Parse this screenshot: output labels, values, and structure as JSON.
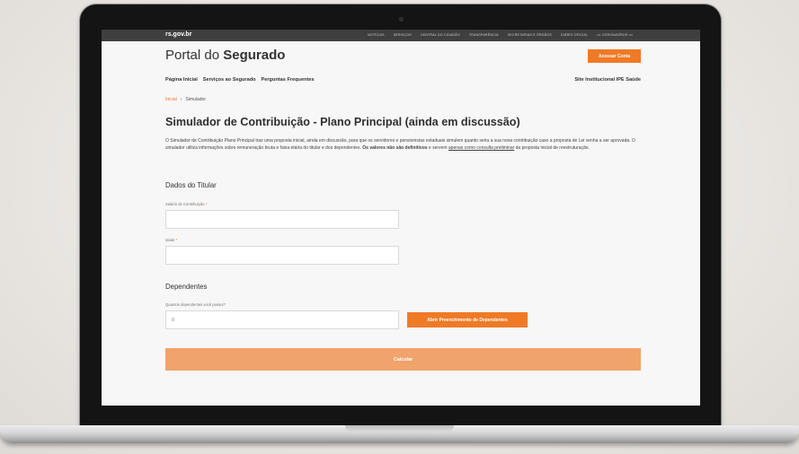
{
  "topbar": {
    "site": "rs.gov.br",
    "links": [
      "NOTÍCIAS",
      "SERVIÇOS",
      "CENTRAL DO CIDADÃO",
      "TRANSPARÊNCIA",
      "SECRETARIAS E ÓRGÃOS",
      "DIÁRIO OFICIAL",
      "••• CORONAVÍRUS •••"
    ]
  },
  "header": {
    "title_prefix": "Portal do ",
    "title_bold": "Segurado",
    "login_button": "Acessar Conta"
  },
  "nav": {
    "items": [
      "Página Inicial",
      "Serviços ao Segurado",
      "Perguntas Frequentes"
    ],
    "right_link": "Site Institucional IPE Saúde"
  },
  "breadcrumb": {
    "home": "Inicial",
    "separator": "›",
    "current": "Simulador"
  },
  "page": {
    "title": "Simulador de Contribuição - Plano Principal (ainda em discussão)",
    "intro": {
      "part1": "O Simulador de Contribuição Plano Principal traz uma proposta inicial, ainda em discussão, para que os servidores e pensionistas estaduais simulem quanto seria a sua nova contribuição caso a proposta de Lei venha a ser aprovada. O simulador utiliza informações sobre remuneração bruta e faixa etária do titular e dos dependentes. ",
      "bold": "Os valores não são definitivos",
      "part2": " e servem ",
      "underline": "apenas como consulta preliminar",
      "part3": " da proposta inicial de reestruturação."
    }
  },
  "titular": {
    "heading": "Dados do Titular",
    "salary_label": "Salário de Contribuição",
    "salary_value": "",
    "age_label": "Idade",
    "age_value": "",
    "required_mark": "*"
  },
  "dependentes": {
    "heading": "Dependentes",
    "count_label": "Quantos dependentes você possui?",
    "count_value": "0",
    "open_button": "Abrir Preenchimento de Dependentes"
  },
  "calculate_button": "Calcular",
  "colors": {
    "accent": "#ef7a26",
    "accent_light": "#f0a36a",
    "topbar": "#3f3f3f"
  }
}
